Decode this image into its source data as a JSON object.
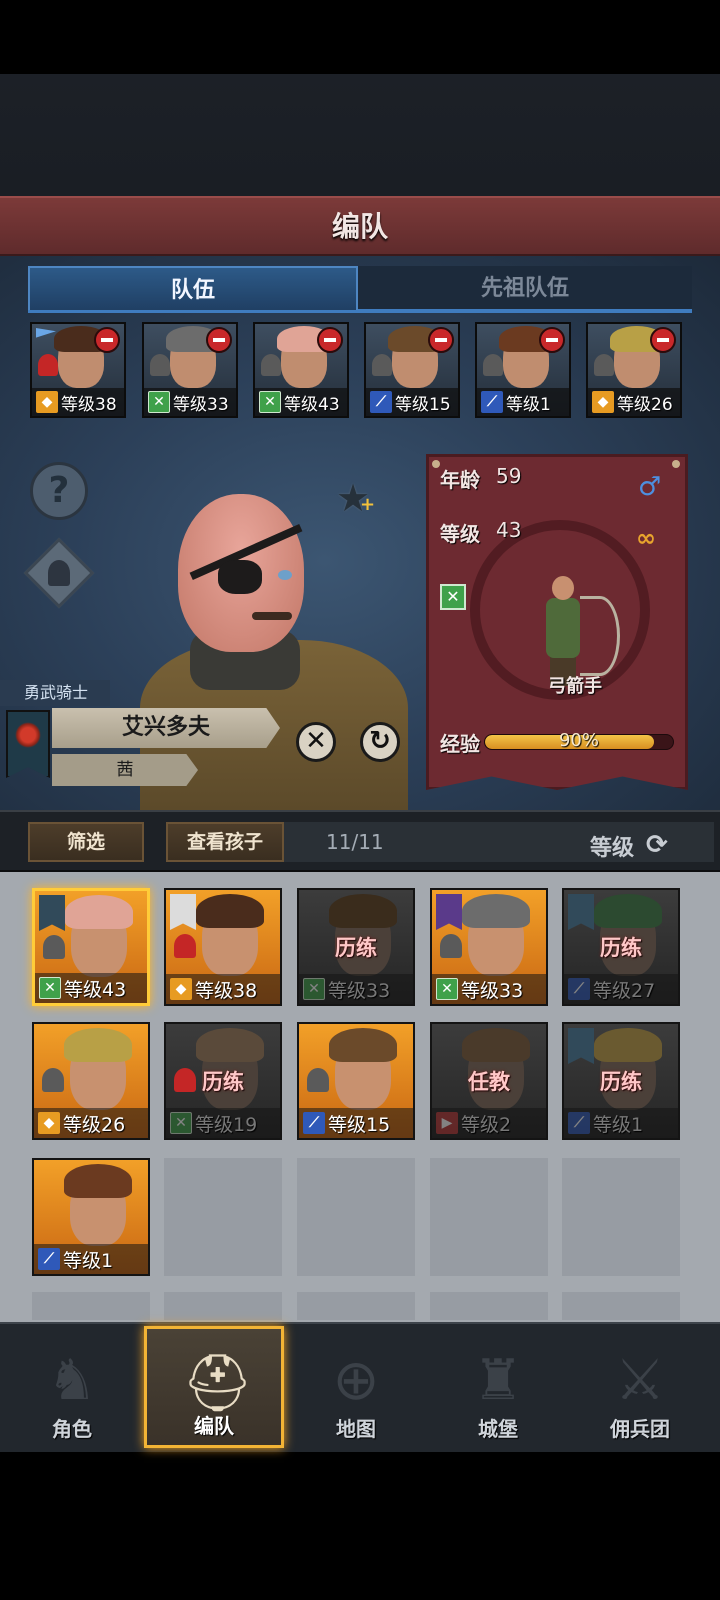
{
  "header": {
    "title": "编队"
  },
  "tabs": [
    {
      "label": "队伍",
      "active": true
    },
    {
      "label": "先祖队伍",
      "active": false
    }
  ],
  "team": [
    {
      "level": "等级38",
      "class": "shield",
      "hair": "#4a2c1c",
      "flag": true,
      "red_person": true
    },
    {
      "level": "等级33",
      "class": "bow",
      "hair": "#6c6c6c",
      "flag": false,
      "red_person": false
    },
    {
      "level": "等级43",
      "class": "bow",
      "hair": "#e0a496",
      "flag": false,
      "red_person": false
    },
    {
      "level": "等级15",
      "class": "sword",
      "hair": "#6b4a2a",
      "flag": false,
      "red_person": false
    },
    {
      "level": "等级1",
      "class": "sword",
      "hair": "#6b3a20",
      "flag": false,
      "red_person": false
    },
    {
      "level": "等级26",
      "class": "shield",
      "hair": "#b8a046",
      "flag": false,
      "red_person": false
    }
  ],
  "hero": {
    "title": "勇武骑士",
    "name": "艾兴多夫",
    "house": "茜",
    "age_label": "年龄",
    "age": "59",
    "level_label": "等级",
    "level": "43",
    "class_name": "弓箭手",
    "exp_label": "经验",
    "exp_text": "90%",
    "exp_fraction": 0.9
  },
  "filter_bar": {
    "filter_label": "筛选",
    "children_label": "查看孩子",
    "count": "11/11",
    "sort_label": "等级"
  },
  "roster": [
    {
      "level": "等级43",
      "class": "bow",
      "hair": "#e0a496",
      "state": "selected",
      "status": "",
      "banner": "blue",
      "person": "grey"
    },
    {
      "level": "等级38",
      "class": "shield",
      "hair": "#4a2c1c",
      "state": "normal",
      "status": "",
      "banner": "grey",
      "person": "red"
    },
    {
      "level": "等级33",
      "class": "bow",
      "hair": "#3a2c1c",
      "state": "dim",
      "status": "历练",
      "banner": "",
      "person": ""
    },
    {
      "level": "等级33",
      "class": "bow",
      "hair": "#6c6c6c",
      "state": "normal",
      "status": "",
      "banner": "purple",
      "person": "grey"
    },
    {
      "level": "等级27",
      "class": "sword",
      "hair": "#2c4a30",
      "state": "dim",
      "status": "历练",
      "banner": "blue",
      "person": ""
    },
    {
      "level": "等级26",
      "class": "shield",
      "hair": "#b8a046",
      "state": "normal",
      "status": "",
      "banner": "",
      "person": "grey"
    },
    {
      "level": "等级19",
      "class": "bow",
      "hair": "#5a4a3a",
      "state": "dim",
      "status": "历练",
      "banner": "",
      "person": "red"
    },
    {
      "level": "等级15",
      "class": "sword",
      "hair": "#6b4a2a",
      "state": "normal",
      "status": "",
      "banner": "",
      "person": "grey"
    },
    {
      "level": "等级2",
      "class": "red",
      "hair": "#4a3a2a",
      "state": "dim",
      "status": "任教",
      "banner": "",
      "person": ""
    },
    {
      "level": "等级1",
      "class": "sword",
      "hair": "#6a5a30",
      "state": "dim",
      "status": "历练",
      "banner": "blue",
      "person": ""
    },
    {
      "level": "等级1",
      "class": "sword",
      "hair": "#6b3a20",
      "state": "normal",
      "status": "",
      "banner": "",
      "person": ""
    }
  ],
  "nav": [
    {
      "label": "角色",
      "icon": "knight-icon",
      "active": false
    },
    {
      "label": "编队",
      "icon": "helmet-icon",
      "active": true
    },
    {
      "label": "地图",
      "icon": "compass-map-icon",
      "active": false
    },
    {
      "label": "城堡",
      "icon": "castle-icon",
      "active": false
    },
    {
      "label": "佣兵团",
      "icon": "mercenary-icon",
      "active": false
    }
  ]
}
